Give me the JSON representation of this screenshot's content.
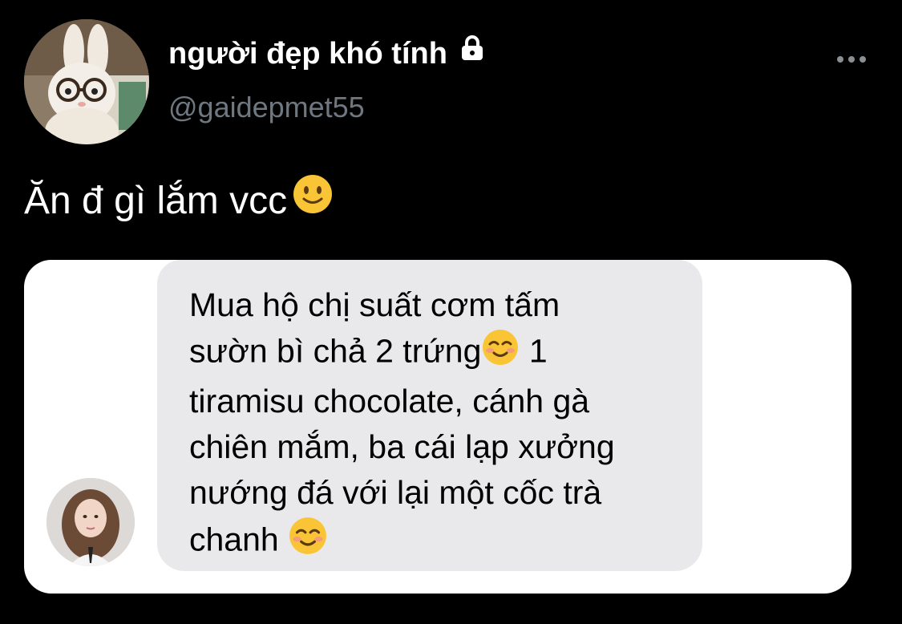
{
  "tweet": {
    "author": {
      "display_name": "người đẹp khó tính",
      "handle": "@gaidepmet55",
      "avatar_icon": "plush-bunny-with-glasses-avatar",
      "protected_icon": "lock-icon"
    },
    "more_icon": "more-dots-icon",
    "text": "Ăn đ gì lắm vcc",
    "text_emoji": "slightly-smiling-face-emoji"
  },
  "quoted_message": {
    "sender_avatar_icon": "girl-portrait-avatar",
    "bubble_color": "#e9e9eb",
    "lines": [
      "Mua hộ chị suất cơm tấm",
      "sườn bì chả 2 trứng",
      "1",
      "tiramisu chocolate, cánh gà",
      "chiên mắm, ba cái lạp xưởng",
      "nướng đá với lại một cốc trà",
      "chanh"
    ],
    "emoji": "smiling-face-emoji"
  },
  "colors": {
    "background": "#000000",
    "handle_text": "#6f7880",
    "card_background": "#ffffff"
  }
}
